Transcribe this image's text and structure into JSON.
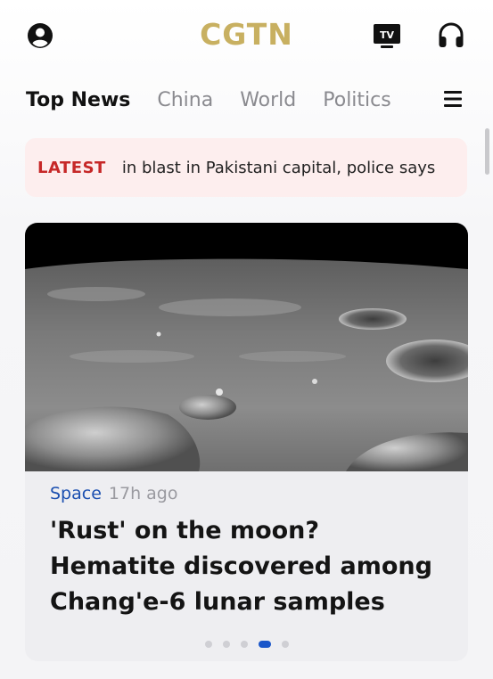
{
  "header": {
    "logo": "CGTN",
    "tv_badge": "TV",
    "icons": [
      "profile-icon",
      "tv-icon",
      "headphones-icon"
    ]
  },
  "tabs": [
    {
      "label": "Top News",
      "active": true
    },
    {
      "label": "China",
      "active": false
    },
    {
      "label": "World",
      "active": false
    },
    {
      "label": "Politics",
      "active": false
    }
  ],
  "ticker": {
    "label": "LATEST",
    "text": "in blast in Pakistani capital, police says"
  },
  "featured": {
    "category": "Space",
    "time": "17h ago",
    "headline": "'Rust' on the moon? Hematite discovered among Chang'e-6 lunar samples",
    "carousel": {
      "total": 5,
      "active_index": 3
    }
  },
  "colors": {
    "logo": "#c8b061",
    "latest_red": "#c62828",
    "category_blue": "#1b4fb0",
    "carousel_active": "#1a56c9"
  }
}
